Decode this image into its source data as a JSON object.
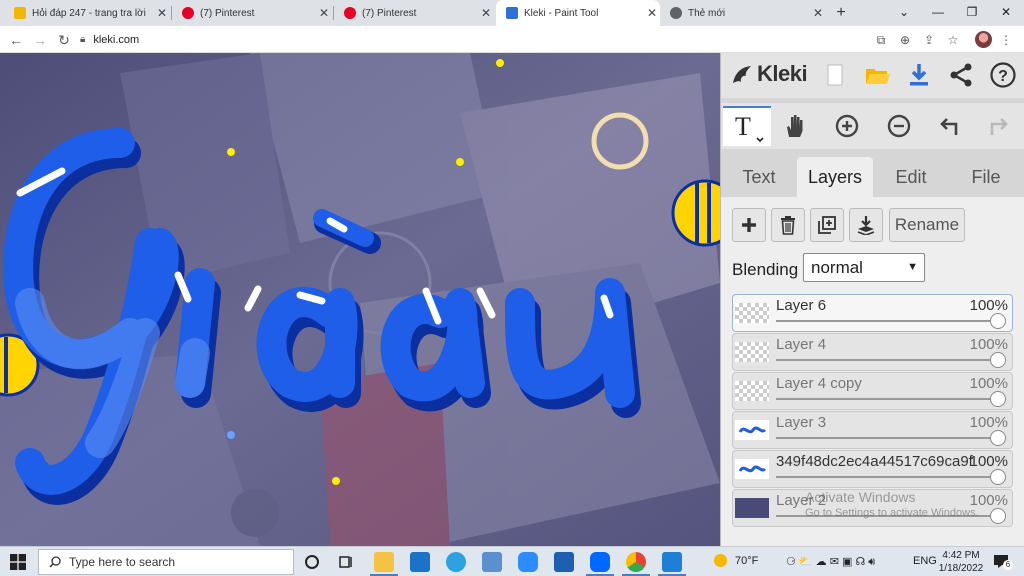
{
  "browser": {
    "tabs": [
      {
        "title": "Hỏi đáp 247 - trang tra lời",
        "favicon_color": "#f2b705",
        "active": false
      },
      {
        "title": "(7) Pinterest",
        "favicon_color": "#e60023",
        "active": false
      },
      {
        "title": "(7) Pinterest",
        "favicon_color": "#e60023",
        "active": false
      },
      {
        "title": "Kleki - Paint Tool",
        "favicon_color": "#2f6fd6",
        "active": true
      },
      {
        "title": "Thẻ mới",
        "favicon_color": "#5f6368",
        "active": false
      }
    ],
    "new_tab_label": "+",
    "url": "kleki.com"
  },
  "canvas": {
    "artwork_text": "Giàu",
    "bg_color": "#5b5b88",
    "letter_color": "#1e5ee8",
    "shadow_color": "#0b2f9e"
  },
  "kleki": {
    "logo": "Kleki",
    "tabs": [
      "Text",
      "Layers",
      "Edit",
      "File"
    ],
    "active_tab": "Layers",
    "rename_label": "Rename",
    "blending_label": "Blending",
    "blending_value": "normal",
    "layers": [
      {
        "name": "Layer 6",
        "opacity": "100%",
        "selected": true
      },
      {
        "name": "Layer 4",
        "opacity": "100%",
        "selected": false
      },
      {
        "name": "Layer 4 copy",
        "opacity": "100%",
        "selected": false
      },
      {
        "name": "Layer 3",
        "opacity": "100%",
        "selected": false
      },
      {
        "name": "349f48dc2ec4a44517c69ca9f",
        "opacity": "100%",
        "selected": false
      },
      {
        "name": "Layer 2",
        "opacity": "100%",
        "selected": false
      }
    ],
    "accent_color": "#2f6fd6"
  },
  "watermark": {
    "line1": "Activate Windows",
    "line2": "Go to Settings to activate Windows."
  },
  "taskbar": {
    "search_placeholder": "Type here to search",
    "weather": "70°F",
    "language": "ENG",
    "time": "4:42 PM",
    "date": "1/18/2022",
    "notification_count": "6"
  }
}
